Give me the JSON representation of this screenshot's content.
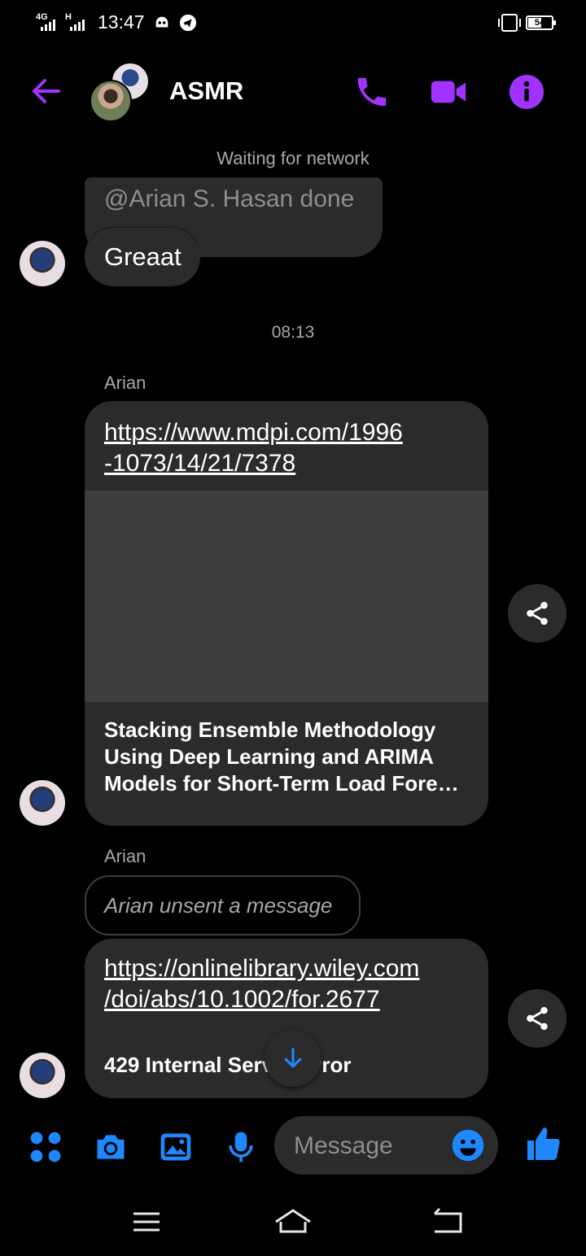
{
  "status_bar": {
    "network_1": "4G",
    "network_2": "H",
    "time": "13:47",
    "battery": "54"
  },
  "header": {
    "title": "ASMR"
  },
  "banner": {
    "network_status": "Waiting for network"
  },
  "messages": {
    "reply_quote": "@Arian S. Hasan done",
    "reply_text": "Greaat",
    "timestamp": "08:13",
    "sender_1": "Arian",
    "link_1_line1": "https://www.mdpi.com/1996",
    "link_1_line2": "-1073/14/21/7378",
    "card_title_line1": "Stacking Ensemble Methodology",
    "card_title_line2": "Using Deep Learning and ARIMA",
    "card_title_line3": "Models for Short-Term Load Fore…",
    "sender_2": "Arian",
    "unsent_text": "Arian unsent a message",
    "link_2_line1": "https://onlinelibrary.wiley.com",
    "link_2_line2": "/doi/abs/10.1002/for.2677",
    "error_text": "429 Internal Server Error"
  },
  "composer": {
    "placeholder": "Message"
  },
  "colors": {
    "accent_purple": "#a033ff",
    "accent_blue": "#1e88ff"
  }
}
